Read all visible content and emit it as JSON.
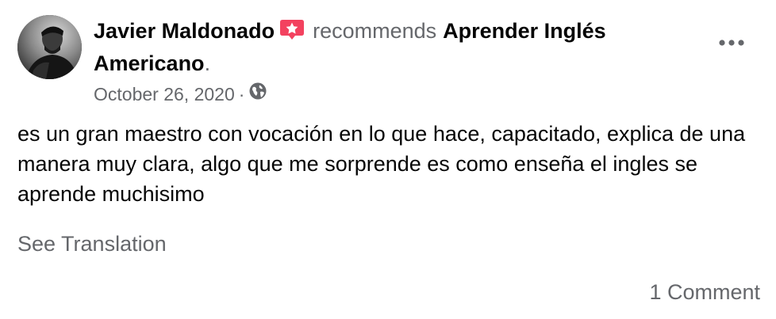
{
  "post": {
    "author": "Javier Maldonado",
    "action": "recommends",
    "page": "Aprender Inglés Americano",
    "period": ".",
    "date": "October 26, 2020",
    "separator": "·",
    "privacy_icon": "globe-icon",
    "badge_icon": "recommendation-star-icon",
    "more_icon": "more-options-icon",
    "body": "es un gran maestro con vocación en lo que hace, capacitado, explica de una manera muy clara, algo que me sorprende es como enseña el ingles se aprende muchisimo",
    "see_translation": "See Translation",
    "comments": "1 Comment"
  },
  "colors": {
    "primary_text": "#050505",
    "secondary_text": "#65676b",
    "badge": "#f3425f",
    "background": "#ffffff"
  }
}
